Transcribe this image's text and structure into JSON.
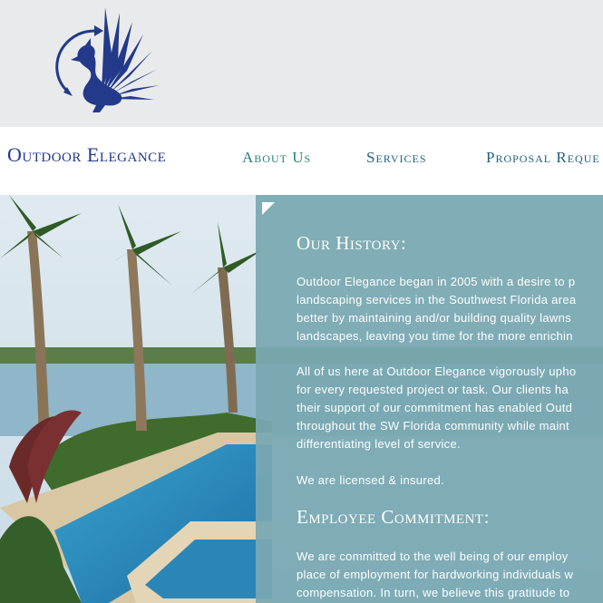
{
  "brand": {
    "name": "Outdoor Elegance",
    "logo_icon": "griffin-logo-icon",
    "color": "#233a8a"
  },
  "nav": {
    "items": [
      {
        "label": "About Us",
        "color": "#2a7f7a",
        "active": true
      },
      {
        "label": "Services",
        "color": "#235e7f"
      },
      {
        "label": "Proposal Reque",
        "color": "#235e7f"
      }
    ]
  },
  "content": {
    "history_heading": "Our History:",
    "history_p1": [
      "Outdoor Elegance began in 2005 with a desire to p",
      "landscaping services in the Southwest Florida area",
      "better by maintaining and/or building quality lawns",
      "landscapes, leaving you time for the more enrichin"
    ],
    "history_p2": [
      "All of us here at Outdoor Elegance vigorously upho",
      "for every requested project or task. Our clients ha",
      "their support of our commitment has enabled Outd",
      "throughout the SW Florida community while maint",
      "differentiating level of service."
    ],
    "licensed": "We are licensed & insured.",
    "commitment_heading": "Employee Commitment:",
    "commitment_p": [
      "We are committed to the well being of our employ",
      "place of employment for hardworking individuals w",
      "compensation. In turn, we believe this gratitude to"
    ]
  },
  "colors": {
    "panel": "#78a8b2",
    "top_band": "#e9eaec"
  }
}
